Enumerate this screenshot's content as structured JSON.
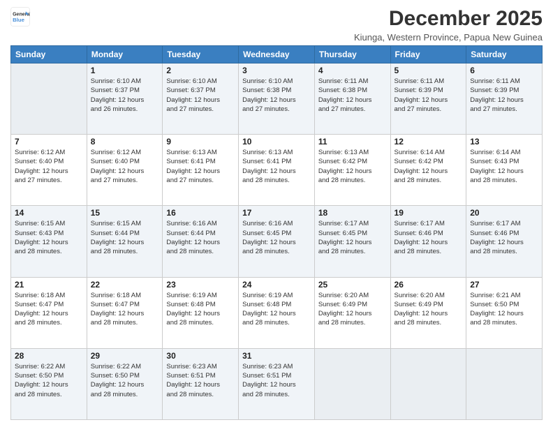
{
  "logo": {
    "line1": "General",
    "line2": "Blue"
  },
  "title": "December 2025",
  "subtitle": "Kiunga, Western Province, Papua New Guinea",
  "weekdays": [
    "Sunday",
    "Monday",
    "Tuesday",
    "Wednesday",
    "Thursday",
    "Friday",
    "Saturday"
  ],
  "weeks": [
    [
      {
        "day": "",
        "info": ""
      },
      {
        "day": "1",
        "info": "Sunrise: 6:10 AM\nSunset: 6:37 PM\nDaylight: 12 hours\nand 26 minutes."
      },
      {
        "day": "2",
        "info": "Sunrise: 6:10 AM\nSunset: 6:37 PM\nDaylight: 12 hours\nand 27 minutes."
      },
      {
        "day": "3",
        "info": "Sunrise: 6:10 AM\nSunset: 6:38 PM\nDaylight: 12 hours\nand 27 minutes."
      },
      {
        "day": "4",
        "info": "Sunrise: 6:11 AM\nSunset: 6:38 PM\nDaylight: 12 hours\nand 27 minutes."
      },
      {
        "day": "5",
        "info": "Sunrise: 6:11 AM\nSunset: 6:39 PM\nDaylight: 12 hours\nand 27 minutes."
      },
      {
        "day": "6",
        "info": "Sunrise: 6:11 AM\nSunset: 6:39 PM\nDaylight: 12 hours\nand 27 minutes."
      }
    ],
    [
      {
        "day": "7",
        "info": "Sunrise: 6:12 AM\nSunset: 6:40 PM\nDaylight: 12 hours\nand 27 minutes."
      },
      {
        "day": "8",
        "info": "Sunrise: 6:12 AM\nSunset: 6:40 PM\nDaylight: 12 hours\nand 27 minutes."
      },
      {
        "day": "9",
        "info": "Sunrise: 6:13 AM\nSunset: 6:41 PM\nDaylight: 12 hours\nand 27 minutes."
      },
      {
        "day": "10",
        "info": "Sunrise: 6:13 AM\nSunset: 6:41 PM\nDaylight: 12 hours\nand 28 minutes."
      },
      {
        "day": "11",
        "info": "Sunrise: 6:13 AM\nSunset: 6:42 PM\nDaylight: 12 hours\nand 28 minutes."
      },
      {
        "day": "12",
        "info": "Sunrise: 6:14 AM\nSunset: 6:42 PM\nDaylight: 12 hours\nand 28 minutes."
      },
      {
        "day": "13",
        "info": "Sunrise: 6:14 AM\nSunset: 6:43 PM\nDaylight: 12 hours\nand 28 minutes."
      }
    ],
    [
      {
        "day": "14",
        "info": "Sunrise: 6:15 AM\nSunset: 6:43 PM\nDaylight: 12 hours\nand 28 minutes."
      },
      {
        "day": "15",
        "info": "Sunrise: 6:15 AM\nSunset: 6:44 PM\nDaylight: 12 hours\nand 28 minutes."
      },
      {
        "day": "16",
        "info": "Sunrise: 6:16 AM\nSunset: 6:44 PM\nDaylight: 12 hours\nand 28 minutes."
      },
      {
        "day": "17",
        "info": "Sunrise: 6:16 AM\nSunset: 6:45 PM\nDaylight: 12 hours\nand 28 minutes."
      },
      {
        "day": "18",
        "info": "Sunrise: 6:17 AM\nSunset: 6:45 PM\nDaylight: 12 hours\nand 28 minutes."
      },
      {
        "day": "19",
        "info": "Sunrise: 6:17 AM\nSunset: 6:46 PM\nDaylight: 12 hours\nand 28 minutes."
      },
      {
        "day": "20",
        "info": "Sunrise: 6:17 AM\nSunset: 6:46 PM\nDaylight: 12 hours\nand 28 minutes."
      }
    ],
    [
      {
        "day": "21",
        "info": "Sunrise: 6:18 AM\nSunset: 6:47 PM\nDaylight: 12 hours\nand 28 minutes."
      },
      {
        "day": "22",
        "info": "Sunrise: 6:18 AM\nSunset: 6:47 PM\nDaylight: 12 hours\nand 28 minutes."
      },
      {
        "day": "23",
        "info": "Sunrise: 6:19 AM\nSunset: 6:48 PM\nDaylight: 12 hours\nand 28 minutes."
      },
      {
        "day": "24",
        "info": "Sunrise: 6:19 AM\nSunset: 6:48 PM\nDaylight: 12 hours\nand 28 minutes."
      },
      {
        "day": "25",
        "info": "Sunrise: 6:20 AM\nSunset: 6:49 PM\nDaylight: 12 hours\nand 28 minutes."
      },
      {
        "day": "26",
        "info": "Sunrise: 6:20 AM\nSunset: 6:49 PM\nDaylight: 12 hours\nand 28 minutes."
      },
      {
        "day": "27",
        "info": "Sunrise: 6:21 AM\nSunset: 6:50 PM\nDaylight: 12 hours\nand 28 minutes."
      }
    ],
    [
      {
        "day": "28",
        "info": "Sunrise: 6:22 AM\nSunset: 6:50 PM\nDaylight: 12 hours\nand 28 minutes."
      },
      {
        "day": "29",
        "info": "Sunrise: 6:22 AM\nSunset: 6:50 PM\nDaylight: 12 hours\nand 28 minutes."
      },
      {
        "day": "30",
        "info": "Sunrise: 6:23 AM\nSunset: 6:51 PM\nDaylight: 12 hours\nand 28 minutes."
      },
      {
        "day": "31",
        "info": "Sunrise: 6:23 AM\nSunset: 6:51 PM\nDaylight: 12 hours\nand 28 minutes."
      },
      {
        "day": "",
        "info": ""
      },
      {
        "day": "",
        "info": ""
      },
      {
        "day": "",
        "info": ""
      }
    ]
  ]
}
